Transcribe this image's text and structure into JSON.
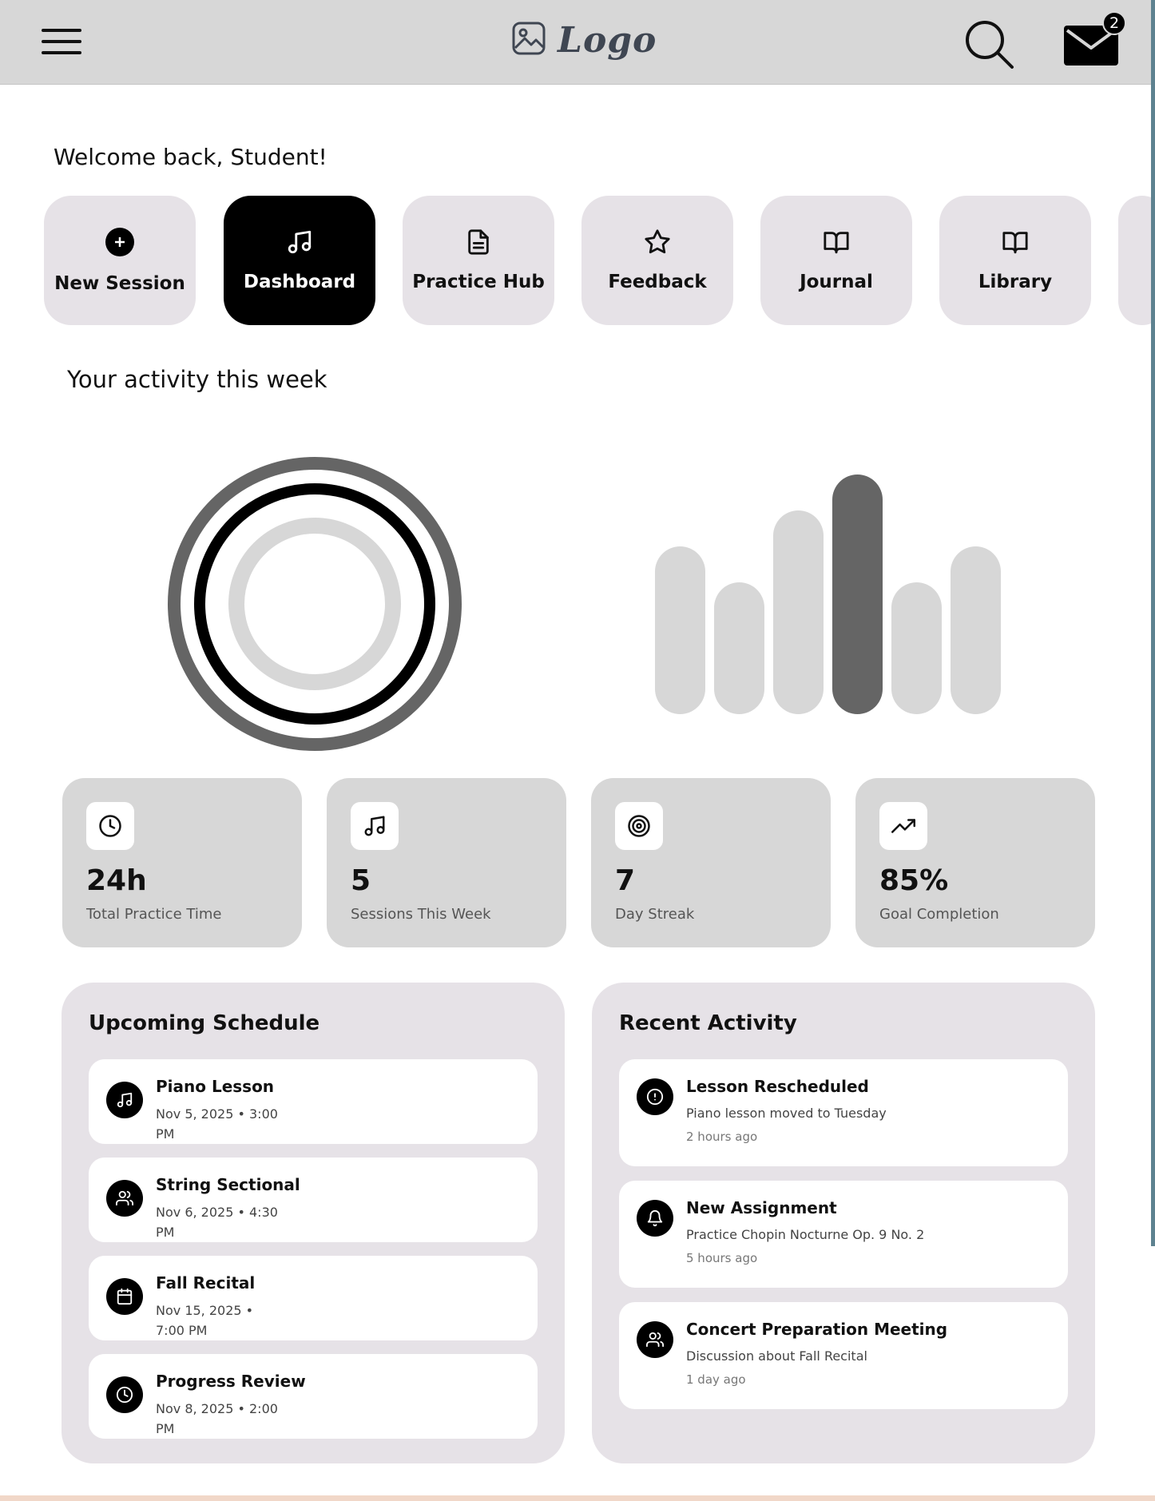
{
  "header": {
    "logo_text": "Logo",
    "mail_badge_count": "2",
    "icons": [
      "hamburger-menu-icon",
      "image-icon",
      "search-icon",
      "mail-icon"
    ]
  },
  "welcome_text": "Welcome back, Student!",
  "nav": {
    "tabs": [
      {
        "label": "New Session",
        "icon": "plus-circle-icon",
        "active": false
      },
      {
        "label": "Dashboard",
        "icon": "music-note-icon",
        "active": true
      },
      {
        "label": "Practice Hub",
        "icon": "document-icon",
        "active": false
      },
      {
        "label": "Feedback",
        "icon": "star-icon",
        "active": false
      },
      {
        "label": "Journal",
        "icon": "book-open-icon",
        "active": false
      },
      {
        "label": "Library",
        "icon": "book-open-icon",
        "active": false
      }
    ]
  },
  "activity": {
    "title": "Your activity this week",
    "colors": {
      "dark": "#656565",
      "black": "#000000",
      "light": "#d7d7d7"
    },
    "bar_levels": [
      0.7,
      0.55,
      0.85,
      1.0,
      0.55,
      0.7
    ]
  },
  "stats": [
    {
      "value": "24h",
      "label": "Total Practice Time",
      "icon": "clock-icon"
    },
    {
      "value": "5",
      "label": "Sessions This Week",
      "icon": "music-note-icon"
    },
    {
      "value": "7",
      "label": "Day Streak",
      "icon": "target-icon"
    },
    {
      "value": "85%",
      "label": "Goal Completion",
      "icon": "trending-up-icon"
    }
  ],
  "schedule": {
    "title": "Upcoming Schedule",
    "items": [
      {
        "title": "Piano Lesson",
        "when": "Nov 5, 2025 • 3:00 PM",
        "icon": "music-note-icon"
      },
      {
        "title": "String Sectional",
        "when": "Nov 6, 2025 • 4:30 PM",
        "icon": "users-icon"
      },
      {
        "title": "Fall Recital",
        "when": "Nov 15, 2025 • 7:00 PM",
        "icon": "calendar-icon"
      },
      {
        "title": "Progress Review",
        "when": "Nov 8, 2025 • 2:00 PM",
        "icon": "clock-icon"
      }
    ]
  },
  "recent": {
    "title": "Recent Activity",
    "items": [
      {
        "title": "Lesson Rescheduled",
        "detail": "Piano lesson moved to Tuesday",
        "time": "2 hours ago",
        "icon": "alert-circle-icon"
      },
      {
        "title": "New Assignment",
        "detail": "Practice Chopin Nocturne Op. 9 No. 2",
        "time": "5 hours ago",
        "icon": "bell-icon"
      },
      {
        "title": "Concert Preparation Meeting",
        "detail": "Discussion about Fall Recital",
        "time": "1 day ago",
        "icon": "users-icon"
      }
    ]
  }
}
